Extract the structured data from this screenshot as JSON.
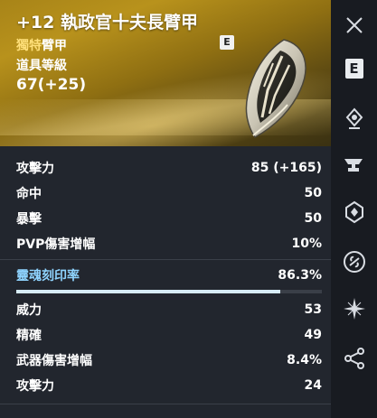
{
  "item": {
    "name": "+12 執政官十夫長臂甲",
    "rarity": "獨特",
    "slot": "臂甲",
    "grade_badge": "E",
    "level_label": "道具等級",
    "level_value": "67(+25)"
  },
  "stats": [
    {
      "label": "攻擊力",
      "value": "85 (+165)"
    },
    {
      "label": "命中",
      "value": "50"
    },
    {
      "label": "暴擊",
      "value": "50"
    },
    {
      "label": "PVP傷害增幅",
      "value": "10%"
    }
  ],
  "soul": {
    "label": "靈魂刻印率",
    "value": "86.3%",
    "progress": 0.863
  },
  "soul_stats": [
    {
      "label": "威力",
      "value": "53"
    },
    {
      "label": "精確",
      "value": "49"
    },
    {
      "label": "武器傷害增幅",
      "value": "8.4%"
    },
    {
      "label": "攻擊力",
      "value": "24"
    }
  ],
  "sidebar": {
    "items": [
      {
        "icon": "close-icon"
      },
      {
        "icon": "grade-e-icon",
        "label": "E"
      },
      {
        "icon": "enchant-gem-icon"
      },
      {
        "icon": "anvil-icon"
      },
      {
        "icon": "soul-engrave-icon"
      },
      {
        "icon": "link-circle-icon"
      },
      {
        "icon": "star-burst-icon"
      },
      {
        "icon": "share-icon"
      }
    ]
  },
  "colors": {
    "header_gold": "#b8921c",
    "rarity": "#ffe07a",
    "soul_label": "#8fd4ff",
    "progress_fill": "#d7ecf7"
  }
}
